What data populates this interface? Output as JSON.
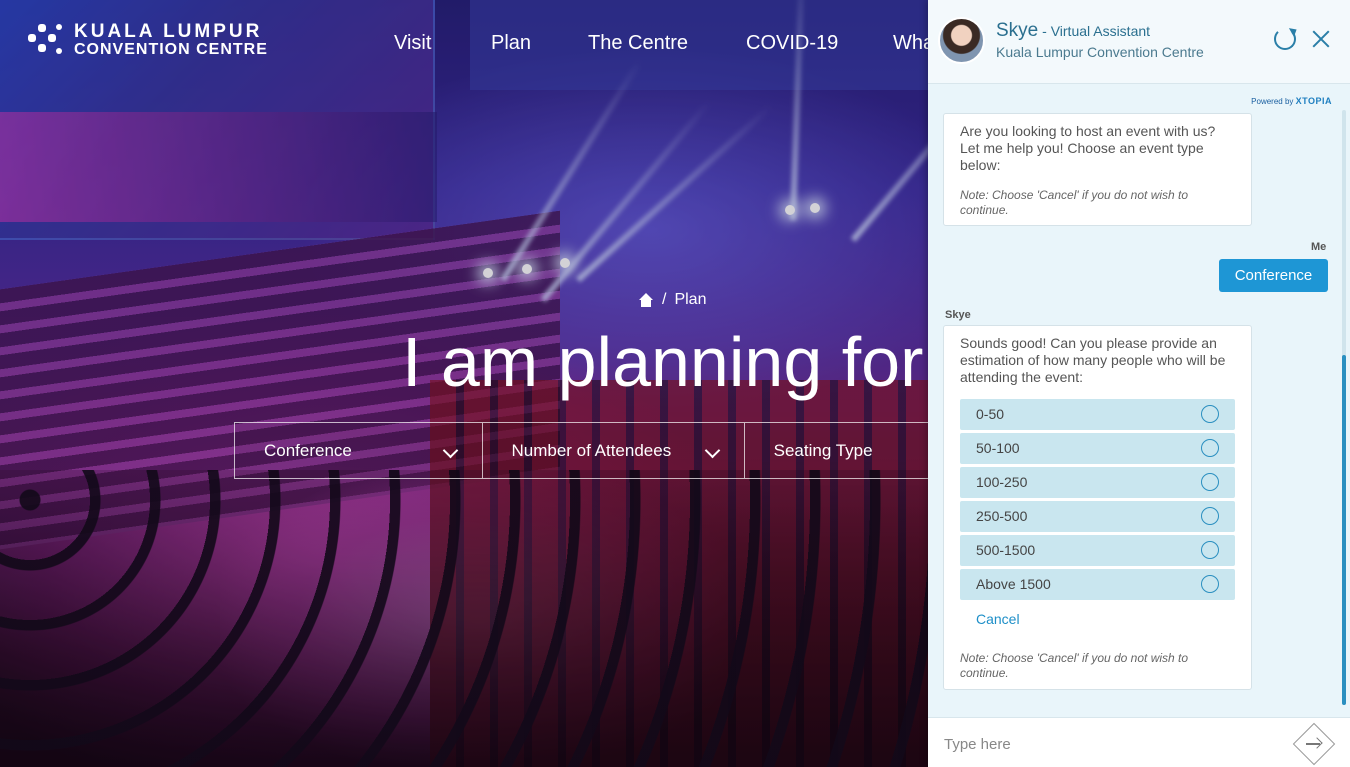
{
  "site": {
    "logo_line1": "KUALA LUMPUR",
    "logo_line2": "CONVENTION CENTRE",
    "nav": [
      "Visit",
      "Plan",
      "The Centre",
      "COVID-19",
      "Wha"
    ]
  },
  "hero": {
    "breadcrumb_current": "Plan",
    "breadcrumb_separator": "/",
    "title": "I am planning for",
    "filters": [
      {
        "label": "Conference"
      },
      {
        "label": "Number of Attendees"
      },
      {
        "label": "Seating Type"
      }
    ]
  },
  "chat": {
    "bot_name": "Skye",
    "bot_role": " - Virtual Assistant",
    "bot_org": "Kuala Lumpur Convention Centre",
    "powered_by": "Powered by",
    "powered_brand": "XTOPIA",
    "message1": "Are you looking to host an event with us? Let me help you! Choose an event type below:",
    "message1_note": "Note: Choose 'Cancel' if you do not wish to continue.",
    "me_label": "Me",
    "me_reply": "Conference",
    "skye_label": "Skye",
    "message2": "Sounds good! Can you please provide an estimation of how many people who will be attending the event:",
    "options": [
      "0-50",
      "50-100",
      "100-250",
      "250-500",
      "500-1500",
      "Above 1500"
    ],
    "cancel_label": "Cancel",
    "message2_note": "Note: Choose 'Cancel' if you do not wish to continue.",
    "input_placeholder": "Type here"
  },
  "colors": {
    "accent": "#1e96d5",
    "chat_bg": "#e9f5fa",
    "option_bg": "#c9e6ef"
  }
}
